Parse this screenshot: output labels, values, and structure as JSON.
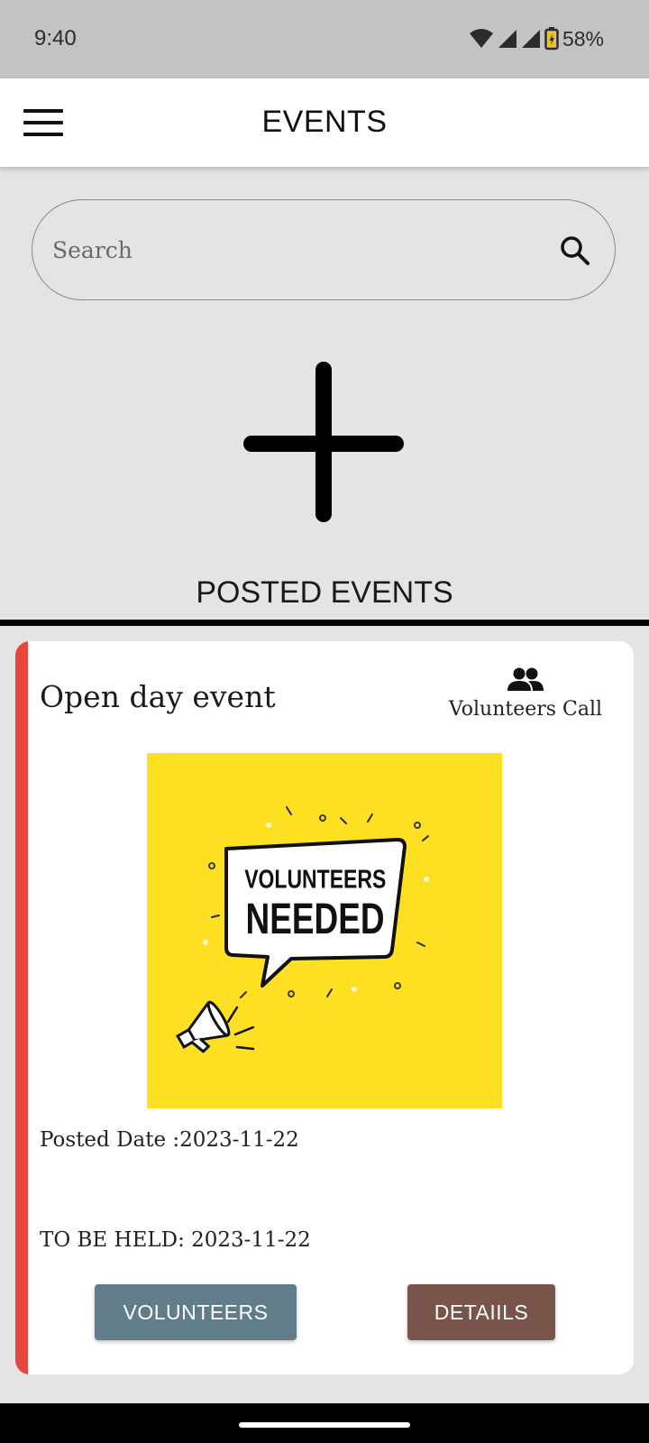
{
  "status_bar": {
    "time": "9:40",
    "battery_percent": "58%",
    "icons": [
      "wifi-icon",
      "signal-icon",
      "signal-icon",
      "battery-charging-icon"
    ]
  },
  "app_bar": {
    "title": "EVENTS",
    "menu_icon": "hamburger-menu-icon"
  },
  "search": {
    "placeholder": "Search",
    "value": "",
    "icon": "search-icon"
  },
  "add_event": {
    "icon": "plus-icon"
  },
  "posted_section": {
    "title": "POSTED EVENTS"
  },
  "events": [
    {
      "title": "Open day event",
      "type_label": "Volunteers Call",
      "type_icon": "group-icon",
      "image": {
        "line1": "VOLUNTEERS",
        "line2": "NEEDED",
        "background": "#fde021"
      },
      "posted_date": "Posted Date :2023-11-22",
      "held_date": "TO BE HELD: 2023-11-22",
      "buttons": {
        "volunteers": "VOLUNTEERS",
        "details": "DETAIILS"
      },
      "accent_color": "#e8463c"
    }
  ],
  "colors": {
    "background": "#e4e4e4",
    "status_bar": "#c3c3c3",
    "volunteers_button": "#617d8a",
    "details_button": "#79544a"
  }
}
